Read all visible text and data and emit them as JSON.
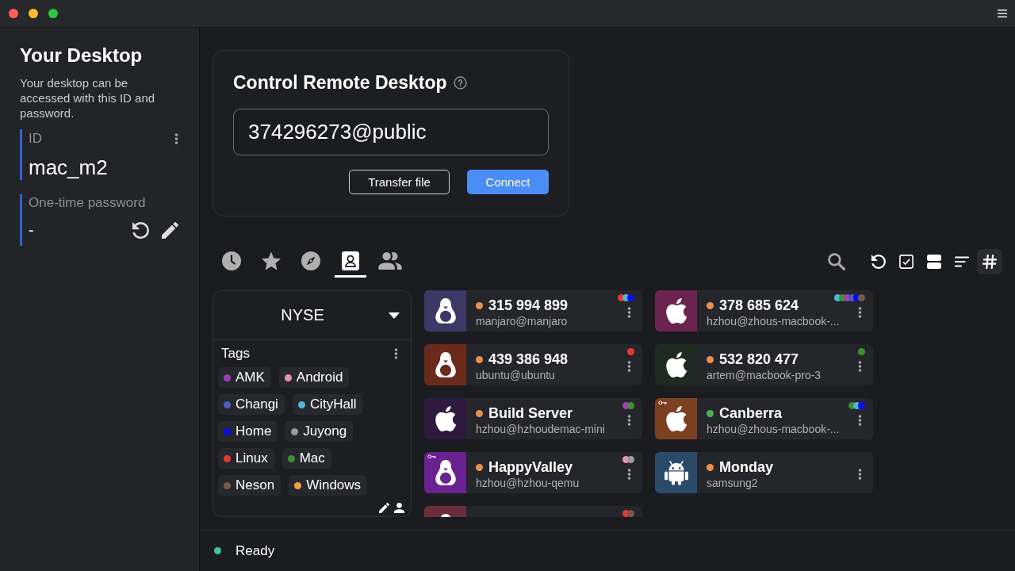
{
  "sidebar": {
    "title": "Your Desktop",
    "description": "Your desktop can be accessed with this ID and password.",
    "id": {
      "label": "ID",
      "value": "mac_m2"
    },
    "password": {
      "label": "One-time password",
      "value": "-"
    }
  },
  "control": {
    "title": "Control Remote Desktop",
    "input": {
      "value": "374296273@public"
    },
    "buttons": [
      {
        "label": "Transfer file",
        "kind": "outline"
      },
      {
        "label": "Connect",
        "kind": "primary"
      }
    ]
  },
  "tabs": [
    {
      "kind": "recent",
      "selected": false
    },
    {
      "kind": "favorites",
      "selected": false
    },
    {
      "kind": "discovered",
      "selected": false
    },
    {
      "kind": "address_book",
      "selected": true
    },
    {
      "kind": "groups",
      "selected": false
    }
  ],
  "tools": [
    {
      "kind": "search",
      "on": false
    },
    {
      "kind": "refresh",
      "on": false
    },
    {
      "kind": "select",
      "on": false
    },
    {
      "kind": "view",
      "on": false
    },
    {
      "kind": "sort",
      "on": false
    },
    {
      "kind": "id_format",
      "on": true
    }
  ],
  "address_book": {
    "name": "NYSE",
    "tags_title": "Tags",
    "tags": [
      {
        "label": "AMK",
        "color": "#9c3fb8"
      },
      {
        "label": "Android",
        "color": "#e891b0"
      },
      {
        "label": "Changi",
        "color": "#4a5ec0"
      },
      {
        "label": "CityHall",
        "color": "#4cb8d4"
      },
      {
        "label": "Home",
        "color": "#0a0af0"
      },
      {
        "label": "Juyong",
        "color": "#9a9a9a"
      },
      {
        "label": "Linux",
        "color": "#e8392f"
      },
      {
        "label": "Mac",
        "color": "#3f8f30"
      },
      {
        "label": "Neson",
        "color": "#7a5a4a"
      },
      {
        "label": "Windows",
        "color": "#f0a040"
      }
    ]
  },
  "peers": [
    {
      "title": "315 994 899",
      "subtitle": "manjaro@manjaro",
      "kind": "linux",
      "color": "#3e3866",
      "online": false,
      "key": false,
      "tags": [
        {
          "color": "#e8392f"
        },
        {
          "color": "#4cb8d4"
        },
        {
          "color": "#0a0af0"
        }
      ]
    },
    {
      "title": "378 685 624",
      "subtitle": "hzhou@zhous-macbook-...",
      "kind": "mac",
      "color": "#6b2450",
      "online": false,
      "key": false,
      "tags": [
        {
          "color": "#4cb8d4"
        },
        {
          "color": "#3f8f30"
        },
        {
          "color": "#9c3fb8"
        },
        {
          "color": "#4a5ec0"
        },
        {
          "color": "#0a0af0"
        },
        {
          "color": "#7a5a4a"
        }
      ]
    },
    {
      "title": "439 386 948",
      "subtitle": "ubuntu@ubuntu",
      "kind": "linux",
      "color": "#6a2a1c",
      "online": false,
      "key": false,
      "tags": [
        {
          "color": "#e8392f"
        }
      ]
    },
    {
      "title": "532 820 477",
      "subtitle": "artem@macbook-pro-3",
      "kind": "mac",
      "color": "#1f2a20",
      "online": false,
      "key": false,
      "tags": [
        {
          "color": "#3f8f30"
        }
      ]
    },
    {
      "title": "Build Server",
      "subtitle": "hzhou@hzhoudemac-mini",
      "kind": "mac",
      "color": "#2d1a3d",
      "online": false,
      "key": false,
      "tags": [
        {
          "color": "#9c3fb8"
        },
        {
          "color": "#3f8f30"
        }
      ]
    },
    {
      "title": "Canberra",
      "subtitle": "hzhou@zhous-macbook-...",
      "kind": "mac",
      "color": "#7a4020",
      "online": true,
      "key": true,
      "tags": [
        {
          "color": "#3f8f30"
        },
        {
          "color": "#4cb8d4"
        },
        {
          "color": "#0a0af0"
        }
      ]
    },
    {
      "title": "HappyValley",
      "subtitle": "hzhou@hzhou-qemu",
      "kind": "linux",
      "color": "#6a2290",
      "online": false,
      "key": true,
      "tags": [
        {
          "color": "#e891b0"
        },
        {
          "color": "#9a9a9a"
        }
      ]
    },
    {
      "title": "Monday",
      "subtitle": "samsung2",
      "kind": "android",
      "color": "#2a4a6a",
      "online": false,
      "key": false
    },
    {
      "kind": "linux",
      "color": "#6b2d3a",
      "key": false,
      "tags": [
        {
          "color": "#e8392f"
        },
        {
          "color": "#7a5a4a"
        }
      ]
    }
  ],
  "status": {
    "text": "Ready",
    "online": true
  }
}
